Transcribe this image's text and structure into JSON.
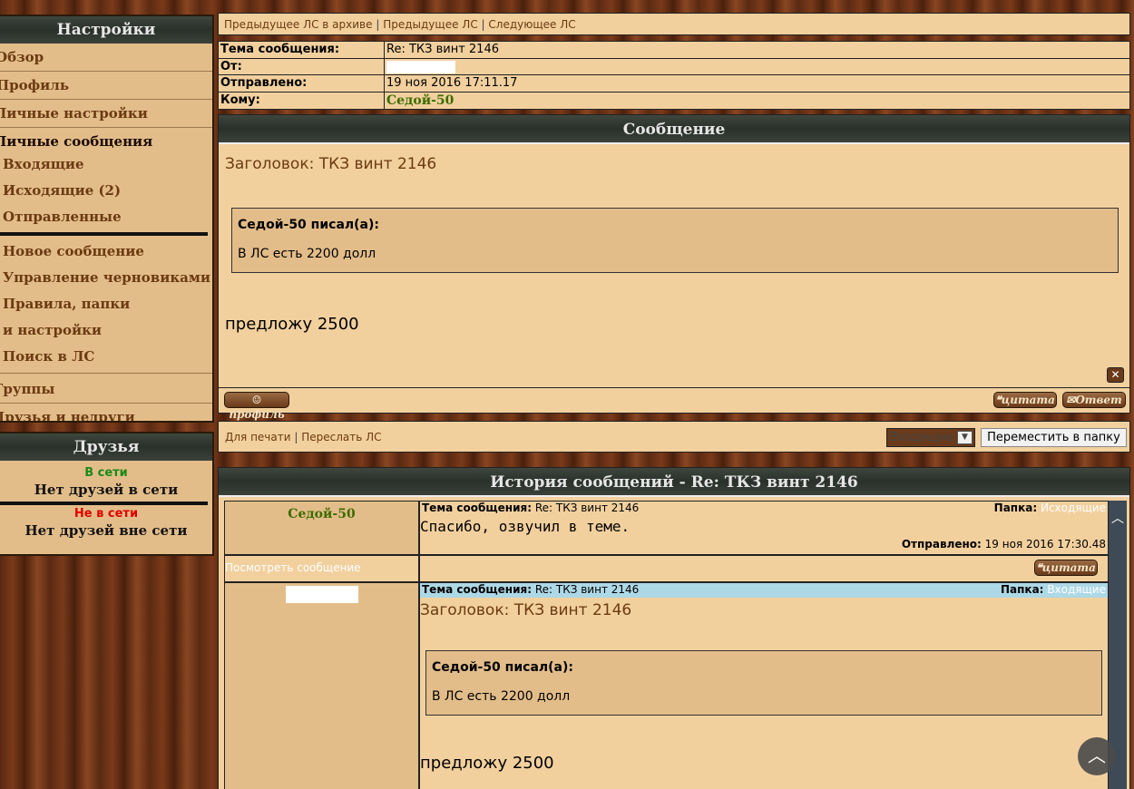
{
  "sidebar": {
    "title": "Настройки",
    "items": [
      {
        "label": "Обзор"
      },
      {
        "label": "Профиль"
      },
      {
        "label": "Личные настройки"
      },
      {
        "label": "Личные сообщения"
      }
    ],
    "pm_items": [
      {
        "label": "Входящие"
      },
      {
        "label": "Исходящие (2)"
      },
      {
        "label": "Отправленные"
      }
    ],
    "pm_tools": [
      {
        "label": "Новое сообщение"
      },
      {
        "label": "Управление черновиками"
      },
      {
        "label": "Правила, папки и настройки"
      },
      {
        "label": "Поиск в ЛС"
      }
    ],
    "bottom_items": [
      {
        "label": "Группы"
      },
      {
        "label": "Друзья и недруги"
      }
    ]
  },
  "friends": {
    "title": "Друзья",
    "online_label": "В сети",
    "online_text": "Нет друзей в сети",
    "offline_label": "Не в сети",
    "offline_text": "Нет друзей вне сети"
  },
  "navbar": {
    "prev_archive": "Предыдущее ЛС в архиве",
    "sep": "|",
    "prev": "Предыдущее ЛС",
    "next": "Следующее ЛС"
  },
  "meta": {
    "subject_label": "Тема сообщения:",
    "subject_value": "Re: ТКЗ винт 2146",
    "from_label": "От:",
    "sent_label": "Отправлено:",
    "sent_value": "19 ноя 2016 17:11.17",
    "to_label": "Кому:",
    "to_value": "Седой-50"
  },
  "message": {
    "header": "Сообщение",
    "subject": "Заголовок: ТКЗ винт 2146",
    "quote_author": "Седой-50 писал(а):",
    "quote_text": "В ЛС есть 2200 долл",
    "body": "предложу 2500",
    "close_icon": "close-icon",
    "profile_button": "профиль",
    "quote_button": "цитата",
    "reply_button": "Ответ"
  },
  "actions": {
    "print": "Для печати",
    "sep": "|",
    "forward": "Переслать ЛС",
    "folder_selected": "Входящие",
    "move_button": "Переместить в папку"
  },
  "history": {
    "header": "История сообщений - Re: ТКЗ винт 2146",
    "entries": [
      {
        "sender": "Седой-50",
        "subject_label": "Тема сообщения:",
        "subject": "Re: ТКЗ винт 2146",
        "folder_label": "Папка:",
        "folder": "Исходящие",
        "body": "Спасибо, озвучил в теме.",
        "sent_label": "Отправлено:",
        "sent": "19 ноя 2016 17:30.48",
        "view_link": "Посмотреть сообщение",
        "quote_button": "цитата"
      },
      {
        "subject_label": "Тема сообщения:",
        "subject": "Re: ТКЗ винт 2146",
        "folder_label": "Папка:",
        "folder": "Входящие",
        "title": "Заголовок: ТКЗ винт 2146",
        "quote_author": "Седой-50 писал(а):",
        "quote_text": "В ЛС есть 2200 долл",
        "body": "предложу 2500"
      }
    ]
  },
  "colors": {
    "panel": "#f2d09e",
    "panel_dark": "#e3bd89",
    "link_brown": "#6b3a12",
    "sender_green": "#3c6b00",
    "online_green": "#1a8a1a",
    "offline_red": "#e00000",
    "header_dark": "#2e342e",
    "highlight_blue": "#add8e6"
  }
}
